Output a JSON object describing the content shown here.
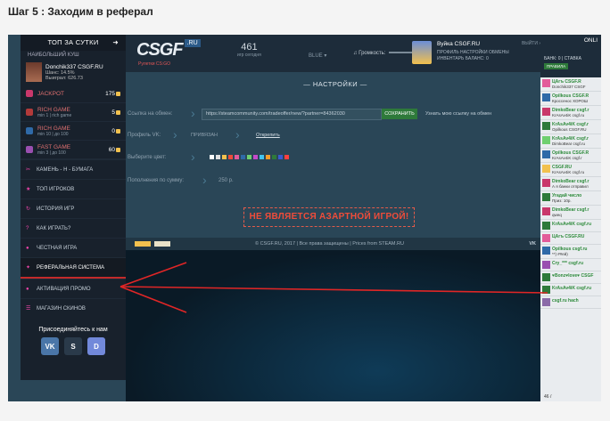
{
  "step_title": "Шаг 5 : Заходим в реферал",
  "sidebar": {
    "top_title": "ТОП ЗА СУТКИ",
    "top_arrow": "➜",
    "winner_label": "НАИБОЛЬШИЙ КУШ",
    "user": {
      "name": "Donchik337 CSGF.RU",
      "stat1": "Шанс: 14.5%",
      "stat2": "Выиграл: 626.73"
    },
    "games": [
      {
        "name": "JACKPOT",
        "sub": "",
        "count": "175",
        "color": "#c9386b"
      },
      {
        "name": "RICH GAME",
        "sub": "min 1 | rich game",
        "count": "5",
        "color": "#b23a3a"
      },
      {
        "name": "RICH GAME",
        "sub": "min 10 | до 100",
        "count": "0",
        "color": "#2f6aa8"
      },
      {
        "name": "FAST GAME",
        "sub": "min 3 | до 100",
        "count": "60",
        "color": "#9a4fb0"
      }
    ],
    "menu": [
      {
        "icon": "✂",
        "label": "КАМЕНЬ - Н - БУМАГА",
        "sub": "min 0.5",
        "active": false
      },
      {
        "icon": "★",
        "label": "ТОП ИГРОКОВ",
        "active": false
      },
      {
        "icon": "↻",
        "label": "ИСТОРИЯ ИГР",
        "active": false
      },
      {
        "icon": "?",
        "label": "КАК ИГРАТЬ?",
        "active": false
      },
      {
        "icon": "●",
        "label": "ЧЕСТНАЯ ИГРА",
        "active": false
      },
      {
        "icon": "✦",
        "label": "РЕФЕРАЛЬНАЯ СИСТЕМА",
        "active": true
      },
      {
        "icon": "●",
        "label": "АКТИВАЦИЯ ПРОМО",
        "active": false
      },
      {
        "icon": "☰",
        "label": "МАГАЗИН СКИНОВ",
        "active": false
      }
    ],
    "join_label": "Присоединяйтесь к нам",
    "socials": [
      {
        "label": "VK",
        "color": "#4a76a8"
      },
      {
        "label": "S",
        "color": "#2a3a4a"
      },
      {
        "label": "D",
        "color": "#7289da"
      }
    ]
  },
  "header": {
    "logo_text": "CSGF",
    "logo_ru": ".RU",
    "logo_sub": "Рулетки CS:GO",
    "online_count": "461",
    "online_label": "игр сегодня",
    "lang": "BLUE",
    "volume_label": "Громкость:",
    "user_name": "Вуйка CSGF.RU",
    "user_links_1": "ПРОФИЛЬ  НАСТРОЙКИ  ОБМЕНЫ",
    "user_links_2": "ИНВЕНТАРЬ  БАЛАНС: 0",
    "exit_label": "ВЫЙТИ ›"
  },
  "settings": {
    "title": "— НАСТРОЙКИ —",
    "trade_label": "Ссылка на обмен:",
    "trade_value": "https://steamcommunity.com/tradeoffer/new/?partner=84362030",
    "save_label": "СОХРАНИТЬ",
    "find_label": "Узнать мою ссылку на обмен",
    "vk_label": "Профиль VK:",
    "vk_value": "ПРИВЯЗАН",
    "vk_link": "Открепить",
    "color_label": "Выберите цвет:",
    "swatches": [
      "#ffffff",
      "#e0e0e0",
      "#f2c14e",
      "#f04c3a",
      "#e35b9a",
      "#2f6aa8",
      "#6fd06f",
      "#c44aca",
      "#42c3ee",
      "#f59c2a",
      "#2e7a3a",
      "#3a5ad0",
      "#ff3f3f"
    ],
    "min_label": "Пополнения по сумму:",
    "min_value": "250 р.",
    "gamble_notice": "НЕ ЯВЛЯЕТСЯ АЗАРТНОЙ ИГРОЙ!"
  },
  "footer": {
    "copyright": "© CSGF.RU, 2017 | Все права защищены | Prices from STEAM.RU",
    "vk": "VK"
  },
  "chat": {
    "online": "ONLI",
    "bank": "БАНК: 0  | СТАВКА",
    "rules": "ПРАВИЛА",
    "messages": [
      {
        "name": "ЦАгъ CSGF.R",
        "text": "Donchik337 CSGF",
        "color": "#e35b9a"
      },
      {
        "name": "Opilkous CSGF.R",
        "text": "Кроссенос ХОРОШ",
        "color": "#2f6aa8"
      },
      {
        "name": "DimkoBear csgf.r",
        "text": "KrAsAv4iK csgf.ru",
        "color": "#c9386b"
      },
      {
        "name": "KrAsAv4iK csgf.r",
        "text": "Opilkous CSGF.RU",
        "color": "#2e7a3a"
      },
      {
        "name": "KrAsAv4iK csgf.r",
        "text": "DimkoBear csgf.ru",
        "color": "#6fd06f"
      },
      {
        "name": "Opilkous CSGF.R",
        "text": "KrAsAv4iK csgf.r",
        "color": "#2f6aa8"
      },
      {
        "name": "CSGF.RU",
        "text": "KrAsAv4iK csgf.ru",
        "color": "#f2c14e"
      },
      {
        "name": "DimkoBear csgf.r",
        "text": "А я банки отправил",
        "color": "#c9386b"
      },
      {
        "name": "Угадай число",
        "text": "Приз: 10р.",
        "color": "#2e7a3a"
      },
      {
        "name": "DimkoBear csgf.r",
        "text": "qweq",
        "color": "#c9386b"
      },
      {
        "name": "KrAsAv4iK csgf.ru",
        "text": "",
        "color": "#2e7a3a"
      },
      {
        "name": "ЦАгъ CSGF.RU",
        "text": "",
        "color": "#e35b9a"
      },
      {
        "name": "Opilkous csgf.ru",
        "text": "**) ##ей)",
        "color": "#2f6aa8"
      },
      {
        "name": "Cry_*** csgf.ru",
        "text": "",
        "color": "#9a4fb0"
      },
      {
        "name": "♥Bonz♥love♥ CSGF",
        "text": "",
        "color": "#2e7a3a"
      },
      {
        "name": "KrAsAv4iK csgf.ru",
        "text": "",
        "color": "#2e7a3a"
      },
      {
        "name": "csgf.ru hach",
        "text": "",
        "color": "#8a6aa8"
      }
    ],
    "count": "46 /"
  }
}
